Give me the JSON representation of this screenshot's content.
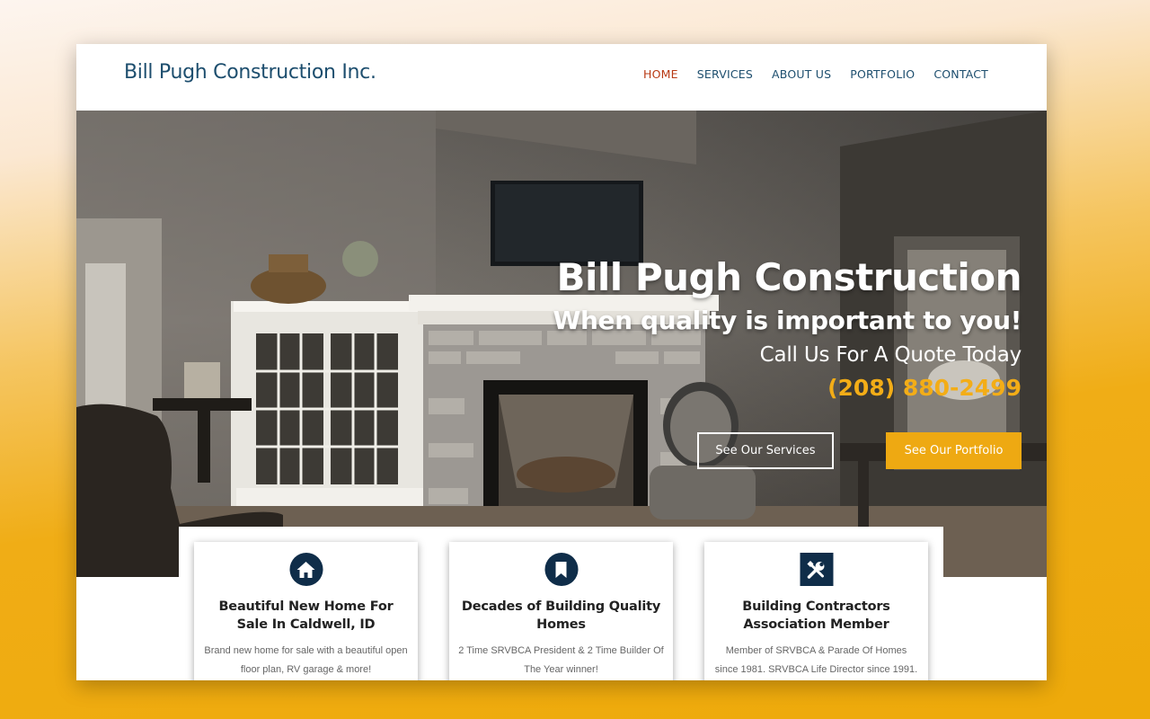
{
  "header": {
    "logo": "Bill Pugh Construction Inc.",
    "nav": [
      {
        "label": "HOME",
        "active": true
      },
      {
        "label": "SERVICES",
        "active": false
      },
      {
        "label": "ABOUT US",
        "active": false
      },
      {
        "label": "PORTFOLIO",
        "active": false
      },
      {
        "label": "CONTACT",
        "active": false
      }
    ]
  },
  "hero": {
    "title": "Bill Pugh Construction",
    "subtitle": "When quality is important to you!",
    "call_text": "Call Us For A Quote Today",
    "phone": "(208) 880-2499",
    "btn_services": "See Our Services",
    "btn_portfolio": "See Our Portfolio"
  },
  "features": [
    {
      "icon": "home-icon",
      "title": "Beautiful New Home For Sale In Caldwell, ID",
      "text": "Brand new home for sale with a beautiful open floor plan, RV garage & more!"
    },
    {
      "icon": "bookmark-icon",
      "title": "Decades of Building Quality Homes",
      "text": "2 Time SRVBCA President & 2 Time Builder Of The Year winner!"
    },
    {
      "icon": "tools-icon",
      "title": "Building Contractors Association Member",
      "text": "Member of SRVBCA & Parade Of Homes since 1981. SRVBCA Life Director since 1991."
    }
  ],
  "colors": {
    "brand": "#1d4e6e",
    "nav_active": "#b83a14",
    "accent": "#eea912",
    "icon_bg": "#0f2d49"
  }
}
